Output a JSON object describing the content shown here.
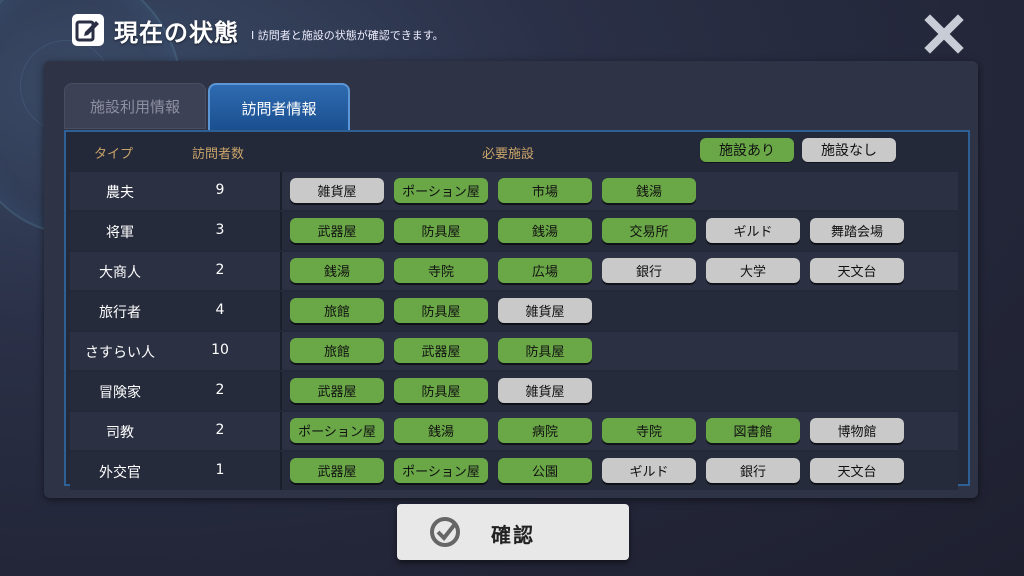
{
  "header": {
    "title": "現在の状態",
    "subtitle": "I 訪問者と施設の状態が確認できます。"
  },
  "tabs": [
    {
      "label": "施設利用情報",
      "active": false
    },
    {
      "label": "訪問者情報",
      "active": true
    }
  ],
  "table": {
    "headers": {
      "type": "タイプ",
      "count": "訪問者数",
      "facilities": "必要施設"
    },
    "legend": {
      "yes": "施設あり",
      "no": "施設なし"
    },
    "rows": [
      {
        "type": "農夫",
        "count": "9",
        "facilities": [
          {
            "name": "雑貨屋",
            "available": false
          },
          {
            "name": "ポーション屋",
            "available": true
          },
          {
            "name": "市場",
            "available": true
          },
          {
            "name": "銭湯",
            "available": true
          }
        ]
      },
      {
        "type": "将軍",
        "count": "3",
        "facilities": [
          {
            "name": "武器屋",
            "available": true
          },
          {
            "name": "防具屋",
            "available": true
          },
          {
            "name": "銭湯",
            "available": true
          },
          {
            "name": "交易所",
            "available": true
          },
          {
            "name": "ギルド",
            "available": false
          },
          {
            "name": "舞踏会場",
            "available": false
          }
        ]
      },
      {
        "type": "大商人",
        "count": "2",
        "facilities": [
          {
            "name": "銭湯",
            "available": true
          },
          {
            "name": "寺院",
            "available": true
          },
          {
            "name": "広場",
            "available": true
          },
          {
            "name": "銀行",
            "available": false
          },
          {
            "name": "大学",
            "available": false
          },
          {
            "name": "天文台",
            "available": false
          }
        ]
      },
      {
        "type": "旅行者",
        "count": "4",
        "facilities": [
          {
            "name": "旅館",
            "available": true
          },
          {
            "name": "防具屋",
            "available": true
          },
          {
            "name": "雑貨屋",
            "available": false
          }
        ]
      },
      {
        "type": "さすらい人",
        "count": "10",
        "facilities": [
          {
            "name": "旅館",
            "available": true
          },
          {
            "name": "武器屋",
            "available": true
          },
          {
            "name": "防具屋",
            "available": true
          }
        ]
      },
      {
        "type": "冒険家",
        "count": "2",
        "facilities": [
          {
            "name": "武器屋",
            "available": true
          },
          {
            "name": "防具屋",
            "available": true
          },
          {
            "name": "雑貨屋",
            "available": false
          }
        ]
      },
      {
        "type": "司教",
        "count": "2",
        "facilities": [
          {
            "name": "ポーション屋",
            "available": true
          },
          {
            "name": "銭湯",
            "available": true
          },
          {
            "name": "病院",
            "available": true
          },
          {
            "name": "寺院",
            "available": true
          },
          {
            "name": "図書館",
            "available": true
          },
          {
            "name": "博物館",
            "available": false
          }
        ]
      },
      {
        "type": "外交官",
        "count": "1",
        "facilities": [
          {
            "name": "武器屋",
            "available": true
          },
          {
            "name": "ポーション屋",
            "available": true
          },
          {
            "name": "公園",
            "available": true
          },
          {
            "name": "ギルド",
            "available": false
          },
          {
            "name": "銀行",
            "available": false
          },
          {
            "name": "天文台",
            "available": false
          }
        ]
      }
    ]
  },
  "confirm_button": {
    "label": "確認"
  },
  "colors": {
    "available": "#6aa847",
    "unavailable": "#c9c9c9",
    "accent": "#2f6bb1",
    "header_text": "#c9a468"
  }
}
